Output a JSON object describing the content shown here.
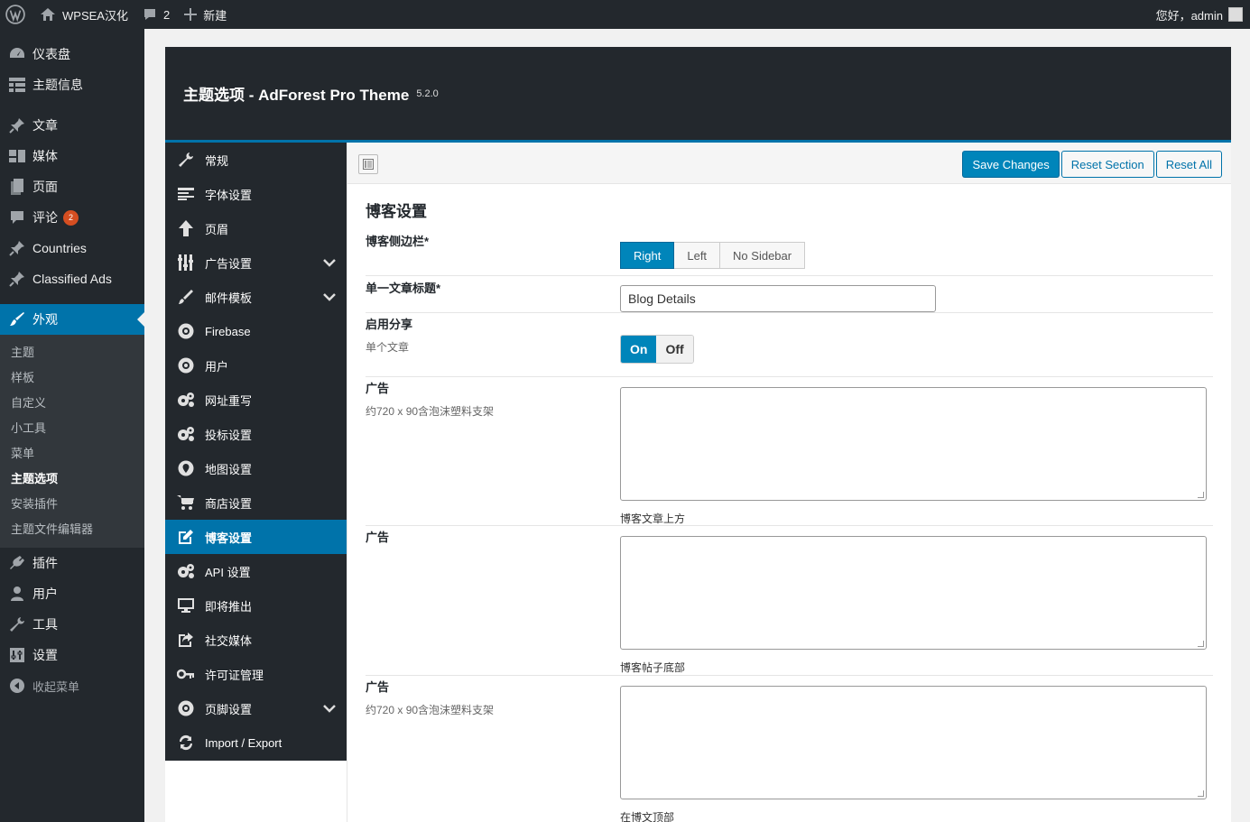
{
  "adminbar": {
    "site_name": "WPSEA汉化",
    "comments_count": "2",
    "new_label": "新建",
    "greeting": "您好，admin"
  },
  "admin_menu": {
    "items_top": [
      {
        "label": "仪表盘",
        "icon": "dashboard-icon"
      },
      {
        "label": "主题信息",
        "icon": "grid-icon"
      }
    ],
    "items_content": [
      {
        "label": "文章",
        "icon": "pin-icon"
      },
      {
        "label": "媒体",
        "icon": "media-icon"
      },
      {
        "label": "页面",
        "icon": "page-icon"
      },
      {
        "label": "评论",
        "icon": "comment-icon",
        "badge": "2"
      },
      {
        "label": "Countries",
        "icon": "pin-icon"
      },
      {
        "label": "Classified Ads",
        "icon": "pin-icon"
      }
    ],
    "current": {
      "label": "外观",
      "icon": "appearance-icon"
    },
    "submenu": [
      "主题",
      "样板",
      "自定义",
      "小工具",
      "菜单",
      "主题选项",
      "安装插件",
      "主题文件编辑器"
    ],
    "submenu_current": "主题选项",
    "items_bottom": [
      {
        "label": "插件",
        "icon": "plugin-icon"
      },
      {
        "label": "用户",
        "icon": "user-icon"
      },
      {
        "label": "工具",
        "icon": "wrench-icon"
      },
      {
        "label": "设置",
        "icon": "settings-icon"
      }
    ],
    "collapse_label": "收起菜单"
  },
  "panel": {
    "title": "主题选项 - AdForest Pro Theme",
    "version": "5.2.0",
    "sections": [
      {
        "label": "常规",
        "icon": "wrench-icon"
      },
      {
        "label": "字体设置",
        "icon": "text-lines-icon"
      },
      {
        "label": "页眉",
        "icon": "arrow-up-icon"
      },
      {
        "label": "广告设置",
        "icon": "sliders-icon",
        "expandable": true
      },
      {
        "label": "邮件模板",
        "icon": "brush-icon",
        "expandable": true
      },
      {
        "label": "Firebase",
        "icon": "gear-circle-icon"
      },
      {
        "label": "用户",
        "icon": "gear-circle-icon"
      },
      {
        "label": "网址重写",
        "icon": "gears-icon"
      },
      {
        "label": "投标设置",
        "icon": "gears-icon"
      },
      {
        "label": "地图设置",
        "icon": "map-pin-icon"
      },
      {
        "label": "商店设置",
        "icon": "cart-icon"
      },
      {
        "label": "博客设置",
        "icon": "edit-icon",
        "active": true
      },
      {
        "label": "API 设置",
        "icon": "gears-icon"
      },
      {
        "label": "即将推出",
        "icon": "monitor-icon"
      },
      {
        "label": "社交媒体",
        "icon": "share-icon"
      },
      {
        "label": "许可证管理",
        "icon": "key-icon"
      },
      {
        "label": "页脚设置",
        "icon": "gear-circle-icon",
        "expandable": true
      },
      {
        "label": "Import / Export",
        "icon": "refresh-icon"
      }
    ],
    "toolbar": {
      "save_label": "Save Changes",
      "reset_section_label": "Reset Section",
      "reset_all_label": "Reset All"
    },
    "section_title": "博客设置",
    "fields": {
      "sidebar": {
        "label": "博客侧边栏*",
        "options": [
          "Right",
          "Left",
          "No Sidebar"
        ],
        "selected": "Right"
      },
      "single_title": {
        "label": "单一文章标题*",
        "value": "Blog Details"
      },
      "share": {
        "label": "启用分享",
        "desc": "单个文章",
        "on": "On",
        "off": "Off",
        "value": "On"
      },
      "ad1": {
        "label": "广告",
        "desc": "约720 x 90含泡沫塑料支架",
        "note": "博客文章上方"
      },
      "ad2": {
        "label": "广告",
        "note": "博客帖子底部"
      },
      "ad3": {
        "label": "广告",
        "desc": "约720 x 90含泡沫塑料支架",
        "note": "在博文顶部"
      }
    }
  }
}
